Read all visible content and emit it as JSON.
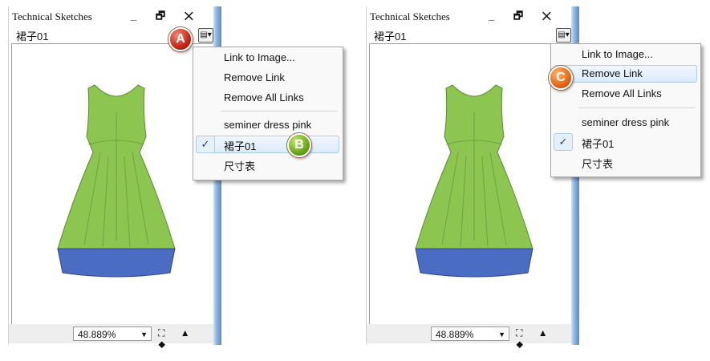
{
  "panel_left": {
    "title": "Technical Sketches",
    "subtitle": "裙子01",
    "window_buttons": "_ 🗗 ✕",
    "menu_button_glyph": "▤▾",
    "zoom": "48.889%",
    "menu": {
      "items": [
        "Link to Image...",
        "Remove Link",
        "Remove All Links"
      ],
      "images": [
        "seminer dress pink",
        "裙子01",
        "尺寸表"
      ],
      "checked_item": "裙子01",
      "check_glyph": "✓"
    },
    "badges": {
      "a": "A",
      "b": "B"
    }
  },
  "panel_right": {
    "title": "Technical Sketches",
    "subtitle": "裙子01",
    "window_buttons": "_ 🗗 ✕",
    "menu_button_glyph": "▤▾",
    "zoom": "48.889%",
    "menu": {
      "items": [
        "Link to Image...",
        "Remove Link",
        "Remove All Links"
      ],
      "images": [
        "seminer dress pink",
        "裙子01",
        "尺寸表"
      ],
      "highlighted_item": "Remove Link",
      "check_glyph": "✓"
    },
    "badges": {
      "c": "C"
    }
  },
  "colors": {
    "dress_green": "#8cc651",
    "dress_blue": "#4a6cc2",
    "menu_highlight": "#dcebfc"
  }
}
